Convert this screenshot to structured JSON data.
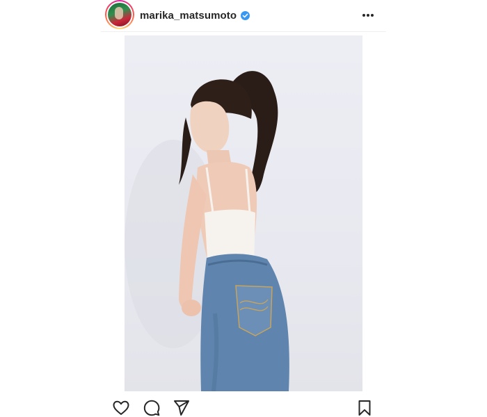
{
  "post": {
    "username": "marika_matsumoto",
    "verified": true,
    "avatar_icon": "profile-avatar",
    "more_icon": "more-horizontal-icon",
    "photo_icon": "post-photo",
    "actions": {
      "like_icon": "heart-icon",
      "comment_icon": "comment-icon",
      "share_icon": "share-icon",
      "save_icon": "bookmark-icon"
    }
  },
  "colors": {
    "verified_badge": "#3897f0",
    "text": "#262626",
    "story_ring": "#d6249f"
  }
}
